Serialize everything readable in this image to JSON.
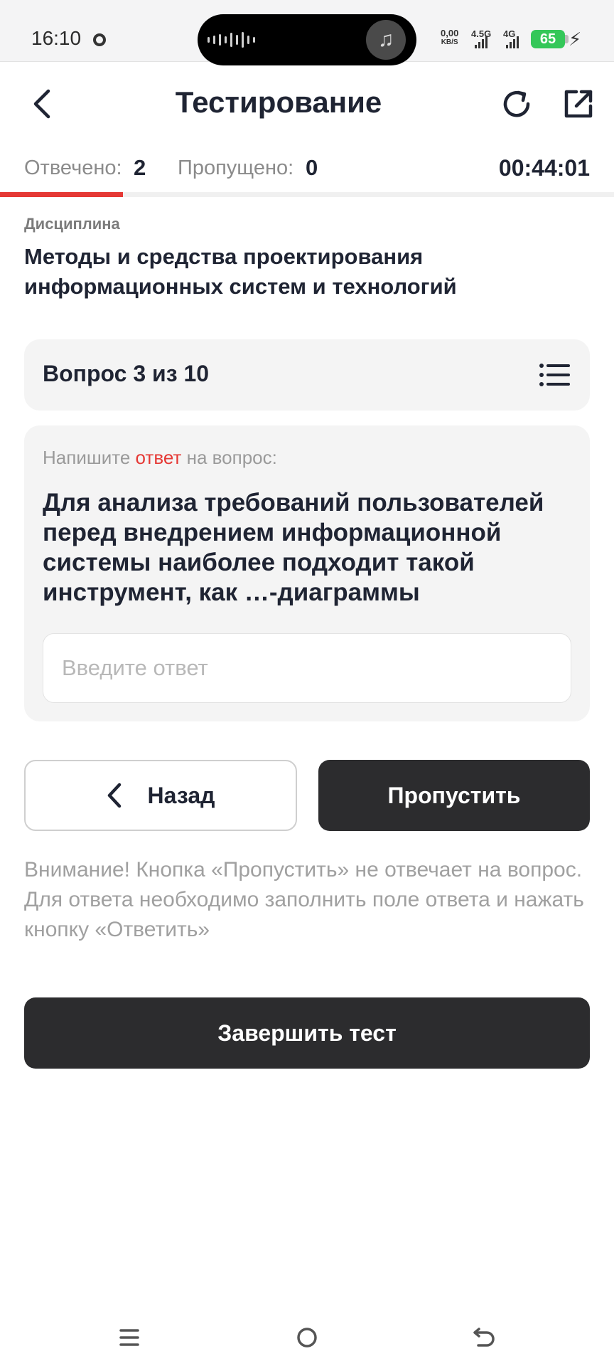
{
  "status_bar": {
    "time": "16:10",
    "net_speed_value": "0,00",
    "net_speed_unit": "KB/S",
    "network_1": "4.5G",
    "network_2": "4G",
    "battery": "65",
    "icons": [
      "chat-icon",
      "audio-wave-icon",
      "music-icon",
      "signal-icon",
      "battery-icon",
      "charging-icon"
    ]
  },
  "header": {
    "title": "Тестирование",
    "icons": [
      "back-icon",
      "refresh-icon",
      "open-external-icon"
    ]
  },
  "stats": {
    "answered_label": "Отвечено:",
    "answered_value": "2",
    "skipped_label": "Пропущено:",
    "skipped_value": "0",
    "timer": "00:44:01",
    "progress_fraction": 0.2
  },
  "discipline": {
    "label": "Дисциплина",
    "name": "Методы и средства проектирования информационных систем и технологий"
  },
  "question_counter": {
    "text": "Вопрос 3 из 10",
    "icon": "list-icon"
  },
  "question": {
    "instruction_before": "Напишите",
    "instruction_accent": "ответ",
    "instruction_after": "на вопрос:",
    "text": "Для анализа требований пользователей перед внедрением информационной системы наиболее подходит такой инструмент, как …-диаграммы",
    "answer_value": "",
    "answer_placeholder": "Введите ответ"
  },
  "buttons": {
    "back": "Назад",
    "skip": "Пропустить",
    "finish": "Завершить тест"
  },
  "notice": "Внимание! Кнопка «Пропустить» не отвечает на вопрос. Для ответа необходимо заполнить поле ответа и нажать кнопку «Ответить»",
  "colors": {
    "accent": "#e53935",
    "dark_button": "#2c2c2e",
    "card_bg": "#f4f4f4"
  }
}
